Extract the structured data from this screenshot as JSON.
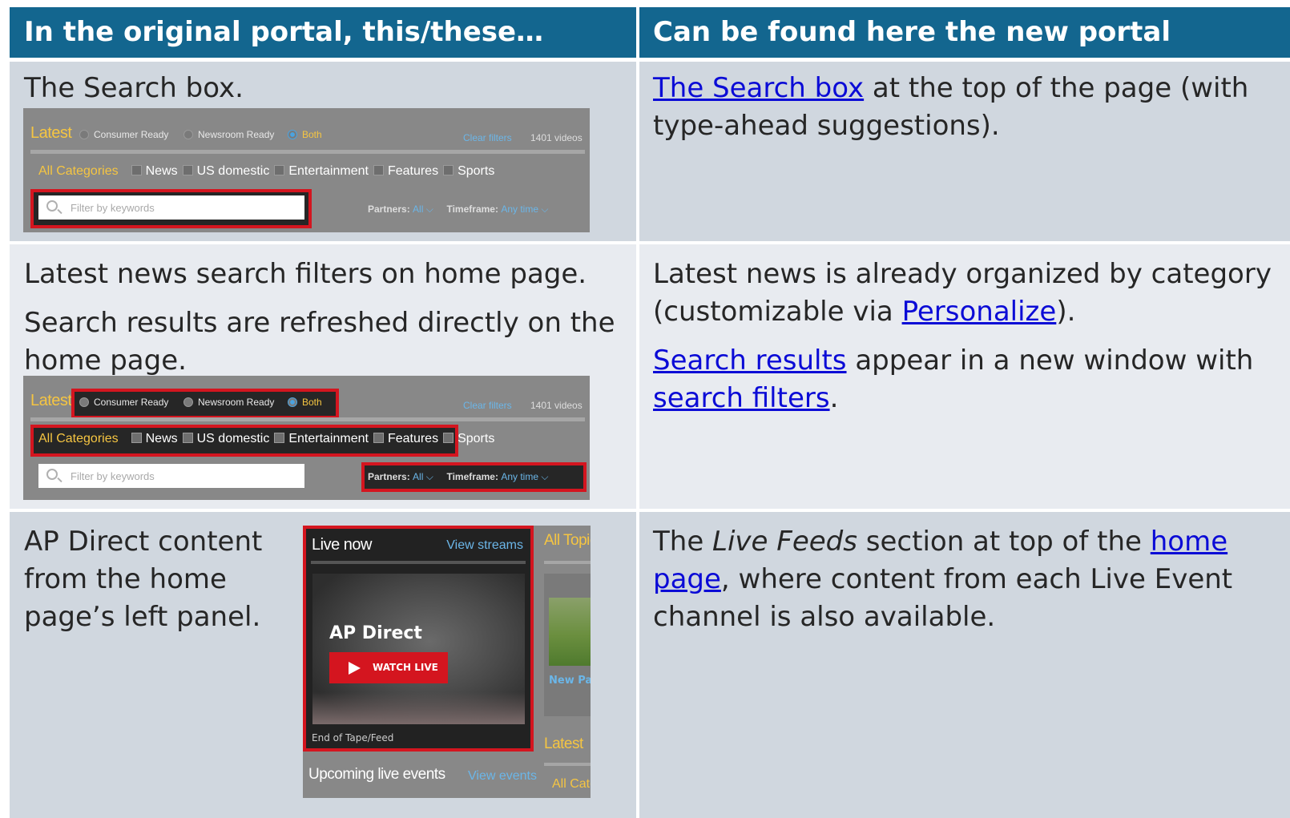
{
  "header": {
    "col1": "In the original portal, this/these…",
    "col2": "Can be found here the new portal"
  },
  "row1": {
    "left_text": "The Search box.",
    "right_link": "The Search box",
    "right_text_after": " at the top of the page (with type-ahead suggestions)."
  },
  "row2": {
    "left_text_1": "Latest news search filters on home page.",
    "left_text_2": "Search results are refreshed directly on the home page.",
    "right_p1_before": "Latest news is already organized by category (customizable via ",
    "right_p1_link": "Personalize",
    "right_p1_after": ").",
    "right_p2_link1": "Search results",
    "right_p2_mid": " appear in a new window with ",
    "right_p2_link2": "search filters",
    "right_p2_after": "."
  },
  "row3": {
    "left_text": "AP Direct content from the home page’s left panel.",
    "right_before": "The ",
    "right_italic": "Live Feeds",
    "right_mid": " section at top of the ",
    "right_link": "home page",
    "right_after": ", where content from each Live Event channel is also available."
  },
  "filter_panel": {
    "latest": "Latest",
    "radio_consumer": "Consumer Ready",
    "radio_newsroom": "Newsroom Ready",
    "radio_both": "Both",
    "clear_filters": "Clear filters",
    "video_count": "1401 videos",
    "all_categories": "All Categories",
    "cat_news": "News",
    "cat_us": "US domestic",
    "cat_ent": "Entertainment",
    "cat_feat": "Features",
    "cat_sports": "Sports",
    "search_placeholder": "Filter by keywords",
    "partners_label": "Partners:",
    "partners_value": "All",
    "timeframe_label": "Timeframe:",
    "timeframe_value": "Any time"
  },
  "live_panel": {
    "title": "Live now",
    "view_streams": "View streams",
    "ap_direct": "AP Direct",
    "watch_live": "WATCH LIVE",
    "end_of_tape": "End of Tape/Feed",
    "upcoming": "Upcoming live events",
    "view_events": "View events",
    "all_topics": "All Topic",
    "new_pa": "New Pa",
    "side_latest": "Latest",
    "all_cate": "All Cate"
  },
  "colors": {
    "header_bg": "#13668f",
    "highlight_red": "#d4151f",
    "link": "#0b0bd6",
    "accent_yellow": "#f5c542"
  }
}
